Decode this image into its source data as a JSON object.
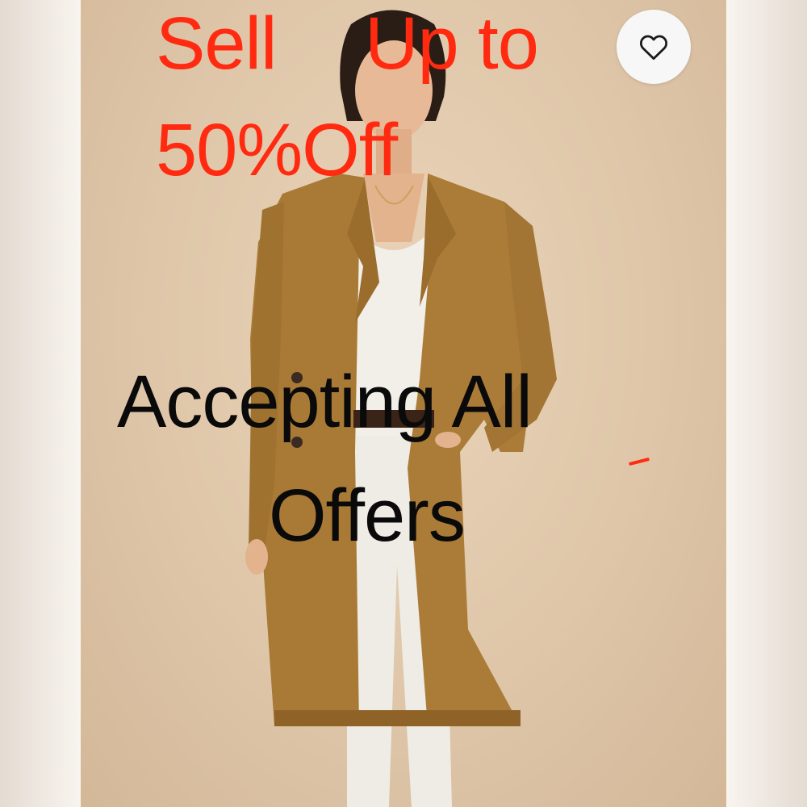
{
  "promo": {
    "line1_word1": "Sell",
    "line1_word2": "Up to",
    "line2": "50%Off",
    "color": "#ff2a10"
  },
  "overlay": {
    "line1": "Accepting All",
    "line2": "Offers",
    "color": "#0a0a0a"
  },
  "like_button": {
    "icon": "heart-outline-icon"
  },
  "photo": {
    "background_color": "#dfc6a9",
    "coat_color": "#a97a35"
  }
}
